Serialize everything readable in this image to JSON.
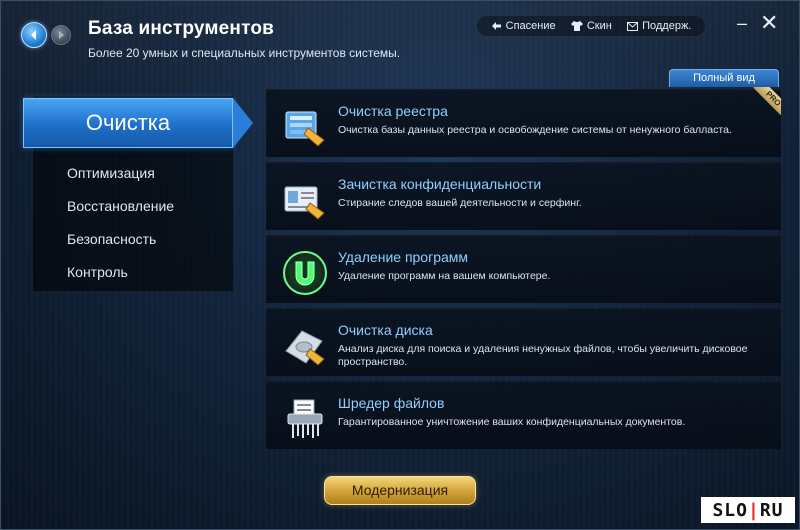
{
  "header": {
    "title": "База инструментов",
    "subtitle": "Более 20 умных и специальных инструментов системы.",
    "links": [
      {
        "label": "Спасение",
        "icon": "rescue-icon"
      },
      {
        "label": "Скин",
        "icon": "shirt-icon"
      },
      {
        "label": "Поддерж.",
        "icon": "mail-icon"
      }
    ],
    "minimize": "–",
    "close": "✕",
    "full_view_label": "Полный вид"
  },
  "sidebar": {
    "active": "Очистка",
    "items": [
      "Оптимизация",
      "Восстановление",
      "Безопасность",
      "Контроль"
    ]
  },
  "tools": [
    {
      "title": "Очистка реестра",
      "desc": "Очистка базы данных реестра и освобождение системы от ненужного балласта.",
      "icon": "registry-cleaner-icon"
    },
    {
      "title": "Зачистка конфиденциальности",
      "desc": "Стирание следов вашей деятельности и серфинг.",
      "icon": "privacy-sweep-icon"
    },
    {
      "title": "Удаление программ",
      "desc": "Удаление программ на вашем компьютере.",
      "icon": "uninstaller-icon"
    },
    {
      "title": "Очистка диска",
      "desc": "Анализ диска для поиска и удаления ненужных файлов, чтобы увеличить дисковое пространство.",
      "icon": "disk-cleaner-icon"
    },
    {
      "title": "Шредер файлов",
      "desc": "Гарантированное уничтожение ваших конфиденциальных документов.",
      "icon": "file-shredder-icon"
    }
  ],
  "pro_badge": "PRO",
  "upgrade_label": "Модернизация",
  "watermark": {
    "left": "SLO",
    "dot": "|",
    "right": "RU"
  },
  "colors": {
    "accent": "#1e6fc9",
    "tool_title": "#8fd0ff",
    "upgrade": "#d4a63a"
  }
}
